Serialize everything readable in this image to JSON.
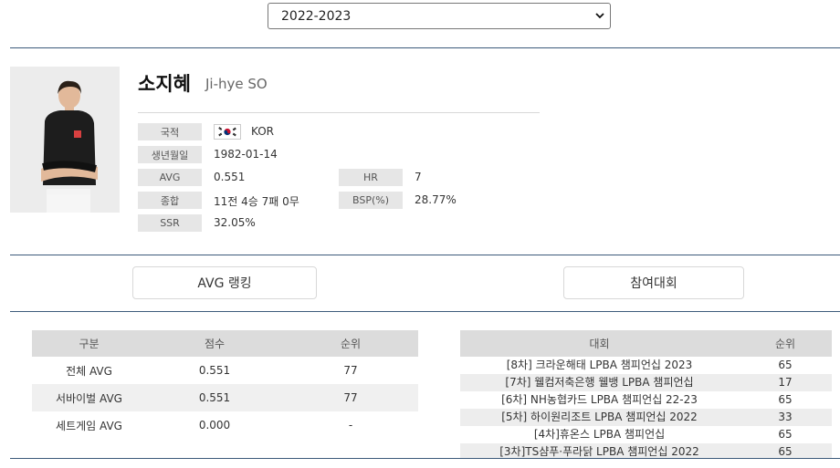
{
  "season_select": {
    "value": "2022-2023"
  },
  "player": {
    "name_kr": "소지혜",
    "name_en": "Ji-hye SO",
    "nationality_label": "국적",
    "nationality": "KOR",
    "birth_label": "생년월일",
    "birth": "1982-01-14",
    "avg_label": "AVG",
    "avg": "0.551",
    "hr_label": "HR",
    "hr": "7",
    "total_label": "종합",
    "total": "11전 4승 7패 0무",
    "bsp_label": "BSP(%)",
    "bsp": "28.77%",
    "ssr_label": "SSR",
    "ssr": "32.05%"
  },
  "tabs": {
    "avg_ranking": "AVG 랭킹",
    "tournaments": "참여대회"
  },
  "avg_table": {
    "headers": [
      "구분",
      "점수",
      "순위"
    ],
    "rows": [
      [
        "전체 AVG",
        "0.551",
        "77"
      ],
      [
        "서바이벌 AVG",
        "0.551",
        "77"
      ],
      [
        "세트게임 AVG",
        "0.000",
        "-"
      ]
    ]
  },
  "tour_table": {
    "headers": [
      "대회",
      "순위"
    ],
    "rows": [
      [
        "[8차] 크라운해태 LPBA 챔피언십 2023",
        "65"
      ],
      [
        "[7차] 웰컴저축은행 웰뱅 LPBA 챔피언십",
        "17"
      ],
      [
        "[6차] NH농협카드 LPBA 챔피언십 22-23",
        "65"
      ],
      [
        "[5차] 하이원리조트 LPBA 챔피언십 2022",
        "33"
      ],
      [
        "[4차]휴온스 LPBA 챔피언십",
        "65"
      ],
      [
        "[3차]TS샴푸·푸라닭 LPBA 챔피언십 2022",
        "65"
      ]
    ]
  },
  "colors": {
    "divider": "#3c5a7a",
    "label_bg": "#e6e6e6",
    "header_bg": "#dcdcdc"
  },
  "icons": {
    "select": "chevron-down-icon",
    "flag": "korea-flag-icon",
    "photo": "player-photo"
  }
}
